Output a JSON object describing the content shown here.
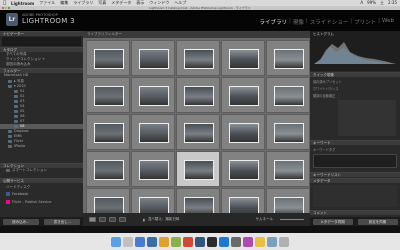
{
  "menubar": {
    "app": "Lightroom",
    "items": [
      "ファイル",
      "編集",
      "ライブラリ",
      "写真",
      "メタデータ",
      "表示",
      "ウィンドウ",
      "ヘルプ"
    ],
    "right": [
      "A",
      "99%",
      "土",
      "2:35"
    ]
  },
  "window": {
    "title": "Lightroom 3 Catalog.lrcat - Adobe Photoshop Lightroom - ライブラリ"
  },
  "identity": {
    "badge": "Lr",
    "small": "ADOBE PHOTOSHOP",
    "name": "LIGHTROOM 3",
    "modules": [
      "ライブラリ",
      "現像",
      "スライドショー",
      "プリント",
      "Web"
    ],
    "active_module": "ライブラリ"
  },
  "left_panel": {
    "navigator": "ナビゲーター",
    "catalog": "カタログ",
    "catalog_items": [
      {
        "label": "すべての写真",
        "count": ""
      },
      {
        "label": "クイックコレクション +",
        "count": ""
      },
      {
        "label": "前回の読み込み",
        "count": ""
      }
    ],
    "folders": "フォルダー",
    "volume": {
      "label": "Macintosh HD",
      "count": ""
    },
    "folder_items": [
      {
        "label": "▸ 写真",
        "count": ""
      },
      {
        "label": "▾ 2010",
        "count": ""
      },
      {
        "label": "01",
        "count": ""
      },
      {
        "label": "02",
        "count": ""
      },
      {
        "label": "03",
        "count": ""
      },
      {
        "label": "04",
        "count": ""
      },
      {
        "label": "05",
        "count": ""
      },
      {
        "label": "06",
        "count": ""
      },
      {
        "label": "07",
        "count": ""
      },
      {
        "label": "08",
        "count": ""
      },
      {
        "label": "Dropbox",
        "count": ""
      },
      {
        "label": "EMB",
        "count": ""
      },
      {
        "label": "Flickr",
        "count": ""
      },
      {
        "label": "iPhoto",
        "count": ""
      }
    ],
    "collections": "コレクション",
    "collection_items": [
      {
        "label": "スマートコレクション",
        "count": ""
      }
    ],
    "publish": "公開サービス",
    "publish_items": [
      {
        "label": "ハードディスク",
        "count": ""
      },
      {
        "label": "Facebook",
        "count": ""
      },
      {
        "label": "Flickr - Publish Service",
        "count": ""
      }
    ],
    "import_btn": "読み込み...",
    "export_btn": "書き出し..."
  },
  "grid": {
    "header": "ライブラリフィルター",
    "rows": 5,
    "cols": 5,
    "selected_index": 17
  },
  "toolbar": {
    "sort": "並べ替え：撮影日時",
    "thumbs": "サムネール"
  },
  "right_panel": {
    "histogram": "ヒストグラム",
    "quick_develop": "クイック現像",
    "quick_rows": [
      "保存済みプリセット",
      "ホワイトバランス",
      "階調の自動補正"
    ],
    "keywords": "キーワード",
    "keyword_rows": [
      "キーワードタグ",
      "キーワードを入力"
    ],
    "keyword_list": "キーワードリスト",
    "metadata": "メタデータ",
    "comments": "コメント",
    "sync_meta_btn": "メタデータ同期",
    "sync_settings_btn": "設定を同期"
  },
  "colors": {
    "app_bg": "#0a0a0a",
    "panel_bg": "#2a2a2a",
    "grid_bg": "#6b6b6b",
    "cell_selected": "#c9c9c9"
  }
}
